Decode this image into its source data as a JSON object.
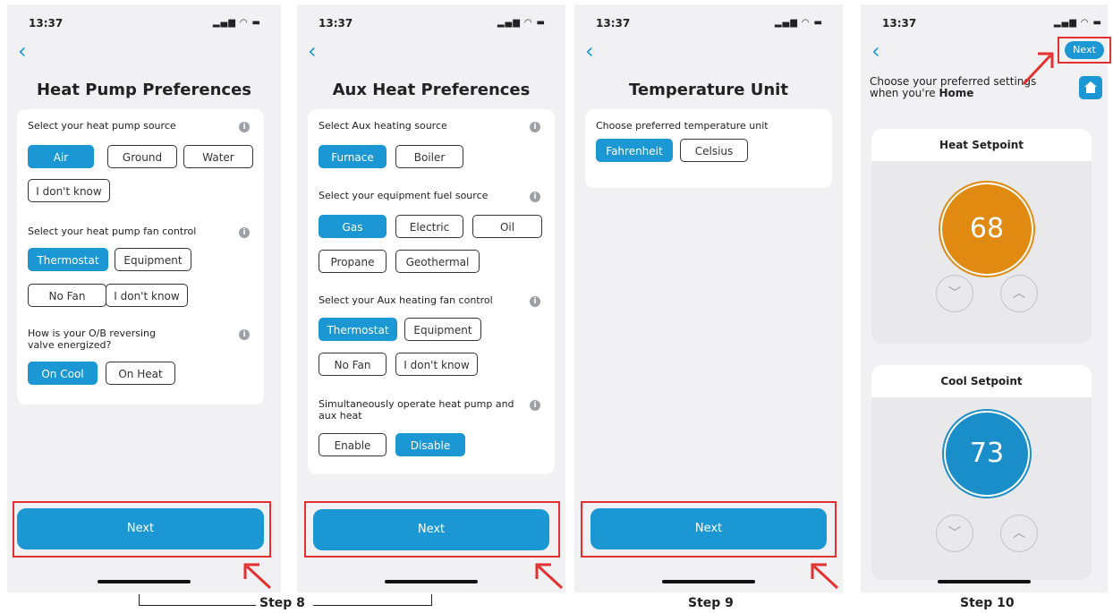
{
  "status": {
    "time": "13:37",
    "icons": "signal-wifi-battery"
  },
  "screen1": {
    "title": "Heat Pump Preferences",
    "q1": "Select your heat pump source",
    "q1_options": [
      "Air",
      "Ground",
      "Water",
      "I don't know"
    ],
    "q2": "Select your heat pump fan control",
    "q2_options": [
      "Thermostat",
      "Equipment",
      "No Fan",
      "I don't know"
    ],
    "q3": "How is your O/B reversing valve energized?",
    "q3_options": [
      "On Cool",
      "On Heat"
    ],
    "next": "Next"
  },
  "screen2": {
    "title": "Aux Heat Preferences",
    "q1": "Select Aux heating source",
    "q1_options": [
      "Furnace",
      "Boiler"
    ],
    "q2": "Select your equipment fuel source",
    "q2_options": [
      "Gas",
      "Electric",
      "Oil",
      "Propane",
      "Geothermal"
    ],
    "q3": "Select your Aux heating fan control",
    "q3_options": [
      "Thermostat",
      "Equipment",
      "No Fan",
      "I don't know"
    ],
    "q4": "Simultaneously operate heat pump and aux heat",
    "q4_options": [
      "Enable",
      "Disable"
    ],
    "next": "Next"
  },
  "screen3": {
    "title": "Temperature Unit",
    "q1": "Choose preferred temperature unit",
    "q1_options": [
      "Fahrenheit",
      "Celsius"
    ],
    "next": "Next"
  },
  "screen4": {
    "next": "Next",
    "intro_line1": "Choose your preferred settings",
    "intro_prefix": "when you're ",
    "intro_bold": "Home",
    "heat_title": "Heat Setpoint",
    "heat_value": "68",
    "cool_title": "Cool Setpoint",
    "cool_value": "73"
  },
  "steps": {
    "step8": "Step 8",
    "step9": "Step 9",
    "step10": "Step 10"
  },
  "colors": {
    "accent": "#1b97d3",
    "heat": "#e08a12",
    "cool": "#1a8ec8",
    "highlight": "#e53030"
  },
  "icons": [
    "back-chevron-icon",
    "info-icon",
    "home-icon",
    "chevron-down-icon",
    "chevron-up-icon",
    "red-arrow-icon"
  ]
}
